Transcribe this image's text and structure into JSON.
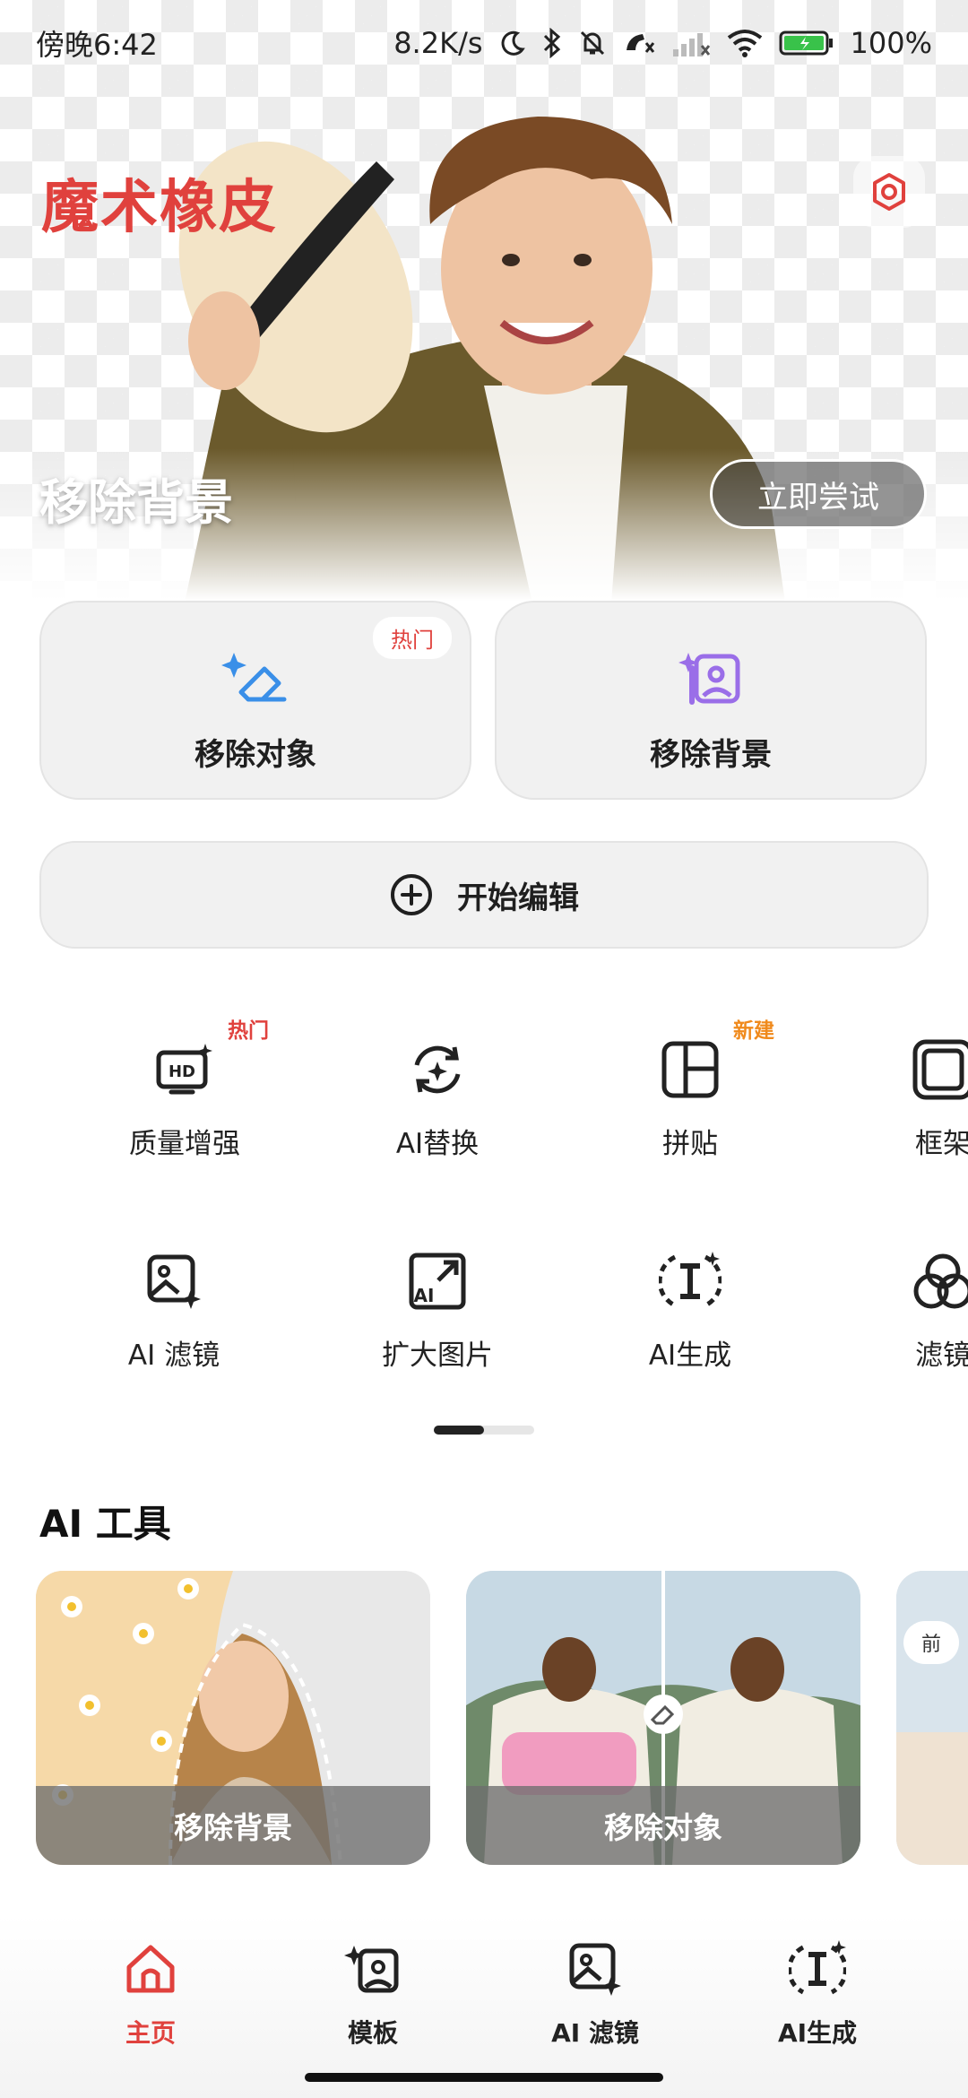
{
  "status_bar": {
    "time": "傍晚6:42",
    "network_speed": "8.2K/s",
    "battery": "100%"
  },
  "hero": {
    "app_title": "魔术橡皮",
    "caption": "移除背景",
    "try_button": "立即尝试"
  },
  "actions": [
    {
      "label": "移除对象",
      "badge": "热门",
      "icon": "eraser-sparkle-icon"
    },
    {
      "label": "移除背景",
      "icon": "image-sparkle-icon"
    }
  ],
  "start_edit": {
    "label": "开始编辑",
    "icon": "plus-circle-icon"
  },
  "tools": {
    "row1": [
      {
        "label": "质量增强",
        "badge": "热门",
        "badge_color": "#e0413d",
        "icon": "hd-icon"
      },
      {
        "label": "AI替换",
        "icon": "ai-swap-icon"
      },
      {
        "label": "拼贴",
        "badge": "新建",
        "badge_color": "#f08a1c",
        "icon": "collage-icon"
      },
      {
        "label": "框架",
        "icon": "frame-icon"
      }
    ],
    "row2": [
      {
        "label": "AI 滤镜",
        "icon": "ai-filter-icon"
      },
      {
        "label": "扩大图片",
        "icon": "ai-expand-icon"
      },
      {
        "label": "AI生成",
        "icon": "ai-generate-icon"
      },
      {
        "label": "滤镜",
        "icon": "filter-circles-icon"
      }
    ]
  },
  "pager": {
    "pages": 2,
    "current": 1
  },
  "ai_section": {
    "title": "AI 工具",
    "cards": [
      {
        "label": "移除背景"
      },
      {
        "label": "移除对象"
      },
      {
        "before_chip": "前"
      }
    ]
  },
  "bottom_nav": [
    {
      "label": "主页",
      "active": true,
      "icon": "home-icon"
    },
    {
      "label": "模板",
      "icon": "template-icon"
    },
    {
      "label": "AI 滤镜",
      "icon": "ai-filter-icon"
    },
    {
      "label": "AI生成",
      "icon": "ai-generate-icon"
    }
  ],
  "colors": {
    "accent": "#e0413d",
    "new_badge": "#f08a1c",
    "blue_icon": "#3a8fe8",
    "purple_icon": "#9a6ee8"
  }
}
